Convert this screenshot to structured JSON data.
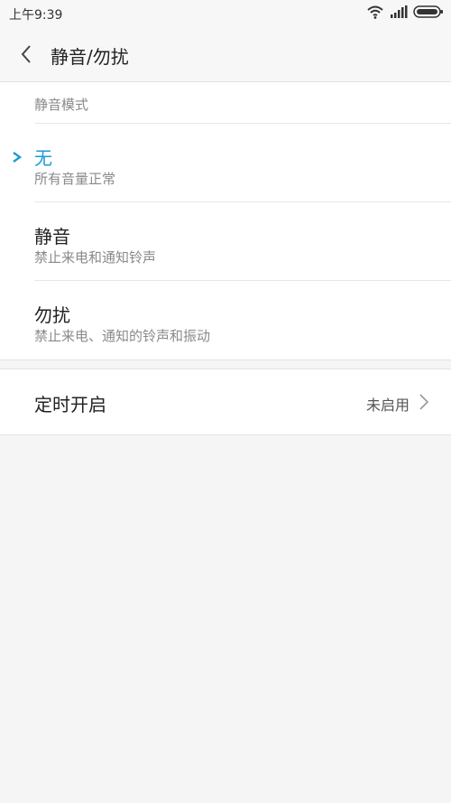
{
  "status_bar": {
    "time": "上午9:39"
  },
  "header": {
    "title": "静音/勿扰"
  },
  "mode_section": {
    "label": "静音模式",
    "options": [
      {
        "title": "无",
        "subtitle": "所有音量正常",
        "selected": true
      },
      {
        "title": "静音",
        "subtitle": "禁止来电和通知铃声",
        "selected": false
      },
      {
        "title": "勿扰",
        "subtitle": "禁止来电、通知的铃声和振动",
        "selected": false
      }
    ]
  },
  "schedule": {
    "label": "定时开启",
    "value": "未启用"
  },
  "colors": {
    "accent": "#1a9cd6",
    "background": "#f5f5f5",
    "panel": "#ffffff"
  }
}
